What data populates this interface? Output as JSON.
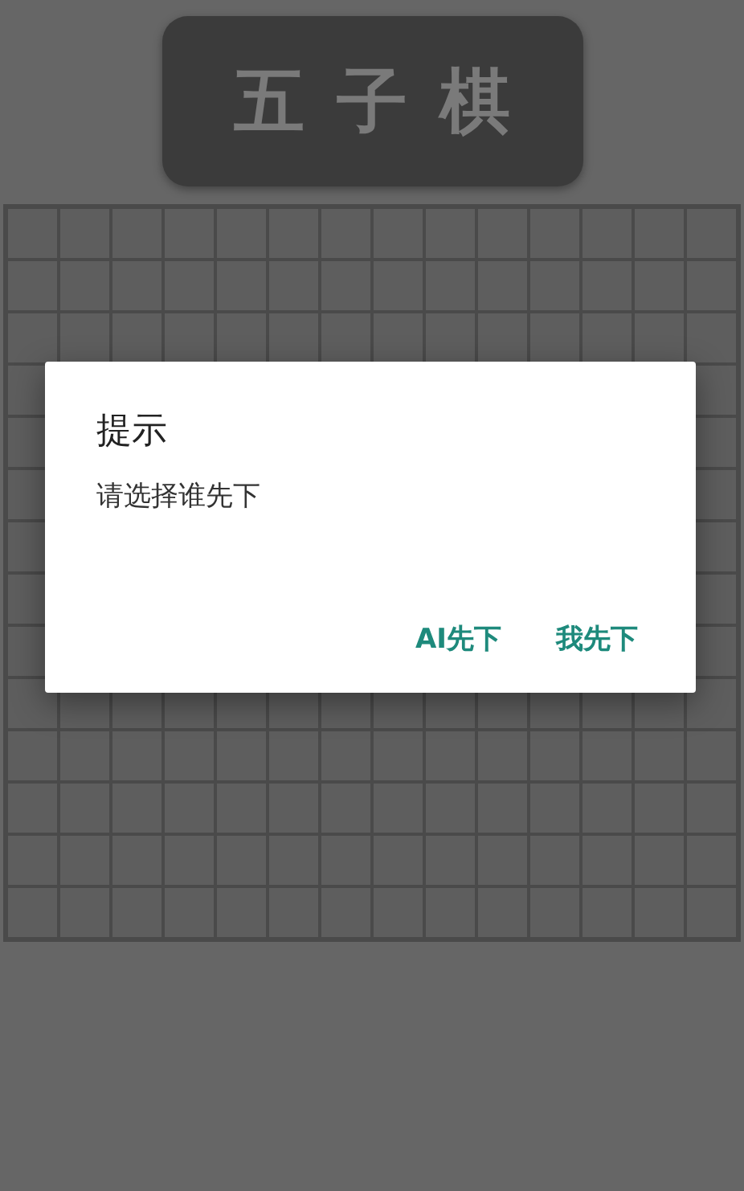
{
  "header": {
    "title": "五子棋"
  },
  "dialog": {
    "title": "提示",
    "message": "请选择谁先下",
    "buttons": [
      "AI先下",
      "我先下"
    ]
  }
}
